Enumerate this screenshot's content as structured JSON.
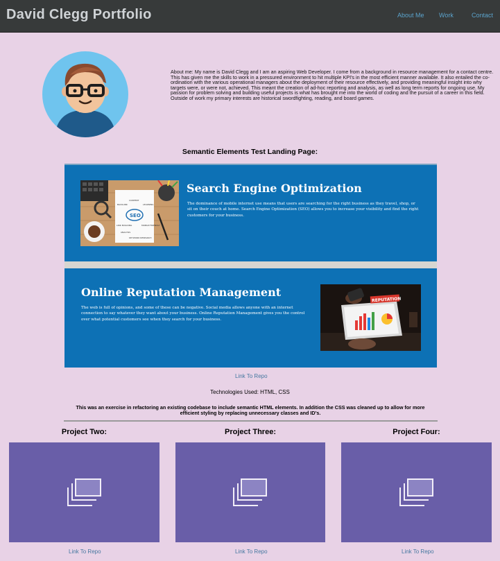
{
  "header": {
    "brand": "David Clegg Portfolio",
    "nav": [
      "About Me",
      "Work",
      "Contact"
    ]
  },
  "about": {
    "text": "About me: My name is David Clegg and I am an aspiring Web Developer. I come from a background in resource management for a contact centre. This has given me the skills to work in a pressured environment to hit multiple KPI's in the most efficient manner available. It also entailed the co-ordination with the various operational managers about the deployment of their resource effectively, and providing meaningful insight into why targets were, or were not, achieved. This meant the creation of ad-hoc reporting and analysis, as well as long term reports for ongoing use. My passion for problem solving and building useful projects is what has brought me into the world of coding and the pursuit of a career in this field. Outside of work my primary interests are historical swordfighting, reading, and board games."
  },
  "project_one": {
    "title": "Semantic Elements Test Landing Page:",
    "features": [
      {
        "title": "Search Engine Optimization",
        "body": "The dominance of mobile internet use means that users are searching for the right business as they travel, shop, or sit on their couch at home. Search Engine Optimization (SEO) allows you to increase your visibility and find the right customers for your business.",
        "image_labels": [
          "SEO",
          "CONTENT",
          "BACKLINK",
          "LEARNING",
          "LINK BUILDING",
          "MOBILE FRIENDLY",
          "ANALYSIS",
          "KEYWORD RESEARCH"
        ]
      },
      {
        "title": "Online Reputation Management",
        "body": "The web is full of opinions, and some of these can be negative. Social media allows anyone with an internet connection to say whatever they want about your business. Online Reputation Management gives you the control over what potential customers see when they search for your business.",
        "image_label": "REPUTATION"
      }
    ],
    "link": "Link To Repo",
    "technologies": "Technologies Used: HTML, CSS",
    "description": "This was an exercise in refactoring an existing codebase to include semantic HTML elements. In addition the CSS was cleaned up to allow for more efficient styling by replacing unnecessary classes and ID's."
  },
  "projects": [
    {
      "title": "Project Two:",
      "link": "Link To Repo"
    },
    {
      "title": "Project Three:",
      "link": "Link To Repo"
    },
    {
      "title": "Project Four:",
      "link": "Link To Repo"
    }
  ],
  "colors": {
    "header_bg": "#373a3a",
    "page_bg": "#e8d2e6",
    "feature_bg": "#0d71b5",
    "project_card_bg": "#695ea8",
    "link": "#4578a0"
  }
}
